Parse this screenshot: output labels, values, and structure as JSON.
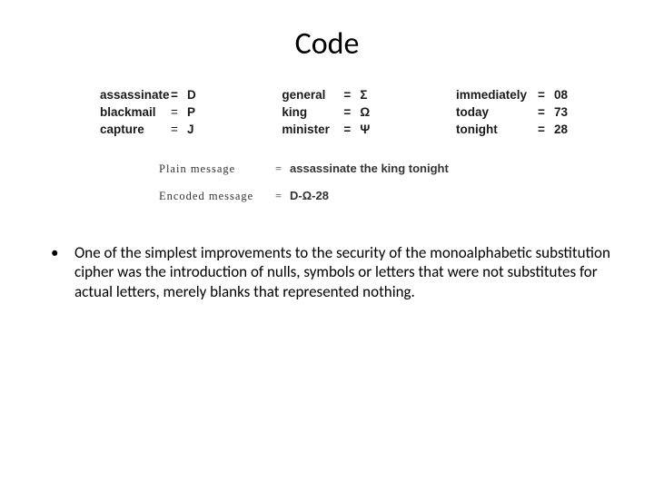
{
  "title": "Code",
  "table": {
    "col1": [
      {
        "word": "assassinate",
        "val": "D"
      },
      {
        "word": "blackmail",
        "val": "P"
      },
      {
        "word": "capture",
        "val": "J"
      }
    ],
    "col2": [
      {
        "word": "general",
        "val": "Σ"
      },
      {
        "word": "king",
        "val": "Ω"
      },
      {
        "word": "minister",
        "val": "Ψ"
      }
    ],
    "col3": [
      {
        "word": "immediately",
        "val": "08"
      },
      {
        "word": "today",
        "val": "73"
      },
      {
        "word": "tonight",
        "val": "28"
      }
    ]
  },
  "eq": "=",
  "messages": {
    "plain_label": "Plain message",
    "plain_value": "assassinate the king tonight",
    "encoded_label": "Encoded message",
    "encoded_value": "D-Ω-28"
  },
  "bullet": {
    "dot": "•",
    "text": "One of the simplest improvements to the security of the monoalphabetic substitution cipher was the introduction of nulls, symbols or letters that were not substitutes for actual letters, merely blanks that represented nothing."
  }
}
